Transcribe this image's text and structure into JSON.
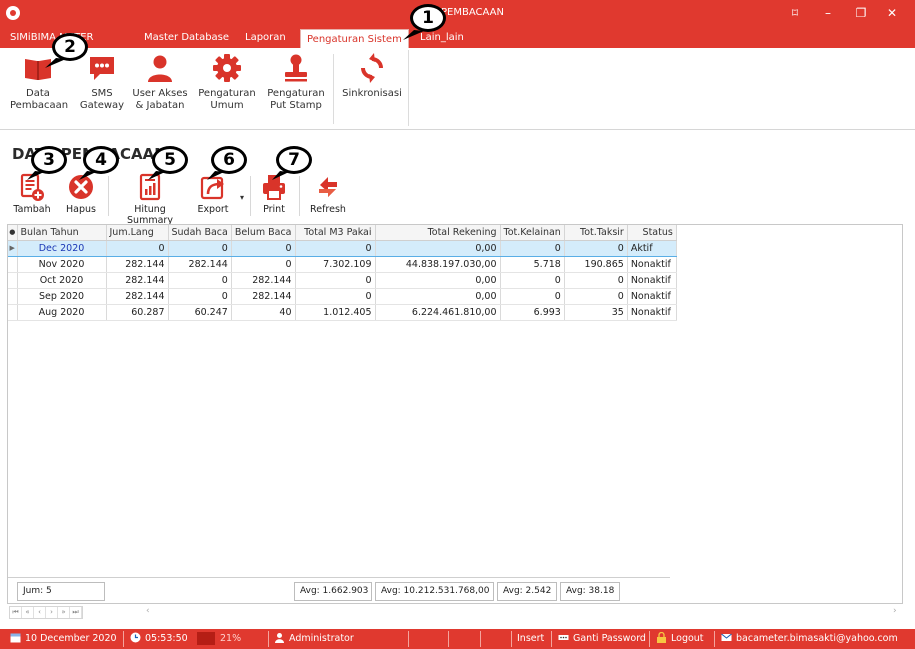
{
  "window": {
    "title": "PEMBACAAN",
    "btn_restore_glyph": "⌑",
    "btn_min_glyph": "–",
    "btn_max_glyph": "❐",
    "btn_close_glyph": "✕"
  },
  "ribbon_tabs": [
    {
      "label": "SIMiBIMA METER"
    },
    {
      "label": "Master Database"
    },
    {
      "label": "Laporan"
    },
    {
      "label": "Pengaturan Sistem",
      "active": true
    },
    {
      "label": "Lain_lain"
    }
  ],
  "ribbon": {
    "data_pembacaan": "Data\nPembacaan",
    "sms_gateway": "SMS\nGateway",
    "user_akses": "User Akses\n& Jabatan",
    "pengaturan_umum": "Pengaturan\nUmum",
    "pengaturan_stamp": "Pengaturan\nPut Stamp",
    "sinkronisasi": "Sinkronisasi"
  },
  "section_title": "DATA PEMBACAAN",
  "toolbar": {
    "tambah": "Tambah",
    "hapus": "Hapus",
    "hitung_summary": "Hitung Summary",
    "export": "Export",
    "print": "Print",
    "refresh": "Refresh"
  },
  "grid": {
    "columns": [
      "Bulan Tahun",
      "Jum.Lang",
      "Sudah Baca",
      "Belum Baca",
      "Total M3 Pakai",
      "Total Rekening",
      "Tot.Kelainan",
      "Tot.Taksir",
      "Status"
    ],
    "rows": [
      [
        "Dec 2020",
        "0",
        "0",
        "0",
        "0",
        "0,00",
        "0",
        "0",
        "Aktif"
      ],
      [
        "Nov 2020",
        "282.144",
        "282.144",
        "0",
        "7.302.109",
        "44.838.197.030,00",
        "5.718",
        "190.865",
        "Nonaktif"
      ],
      [
        "Oct 2020",
        "282.144",
        "0",
        "282.144",
        "0",
        "0,00",
        "0",
        "0",
        "Nonaktif"
      ],
      [
        "Sep 2020",
        "282.144",
        "0",
        "282.144",
        "0",
        "0,00",
        "0",
        "0",
        "Nonaktif"
      ],
      [
        "Aug 2020",
        "60.287",
        "60.247",
        "40",
        "1.012.405",
        "6.224.461.810,00",
        "6.993",
        "35",
        "Nonaktif"
      ]
    ],
    "summary": {
      "count": "Jum: 5",
      "avg_m3": "Avg: 1.662.903",
      "avg_rekening": "Avg: 10.212.531.768,00",
      "avg_kelainan": "Avg: 2.542",
      "avg_taksir": "Avg: 38.18"
    },
    "navigator": [
      "⏮",
      "«",
      "‹",
      "›",
      "»",
      "⏭"
    ]
  },
  "statusbar": {
    "date": "10 December 2020",
    "time": "05:53:50",
    "progress": "21%",
    "user": "Administrator",
    "insert": "Insert",
    "ganti_password": "Ganti Password",
    "logout": "Logout",
    "email": "bacameter.bimasakti@yahoo.com"
  },
  "callouts": [
    "1",
    "2",
    "3",
    "4",
    "5",
    "6",
    "7"
  ],
  "colors": {
    "brand_red": "#e0392f",
    "selected_row": "#d4ecfb",
    "link_blue": "#1b37b5"
  }
}
